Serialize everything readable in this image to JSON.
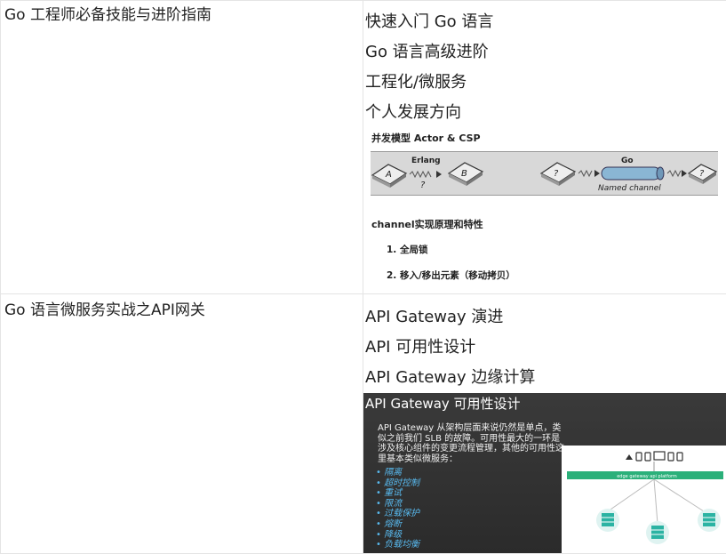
{
  "rows": [
    {
      "course": "Go 工程师必备技能与进阶指南",
      "topics": [
        "快速入门 Go 语言",
        "Go 语言高级进阶",
        "工程化/微服务",
        "个人发展方向"
      ],
      "figure": {
        "heading": "并发模型 Actor & CSP",
        "erlang_label": "Erlang",
        "go_label": "Go",
        "node_a": "A",
        "node_b": "B",
        "q": "?",
        "named_channel": "Named channel",
        "subheading": "channel实现原理和特性",
        "items": [
          "1.  全局锁",
          "2.  移入/移出元素（移动拷贝）"
        ]
      }
    },
    {
      "course": "Go 语言微服务实战之API网关",
      "topics": [
        "API Gateway 演进",
        "API 可用性设计",
        "API Gateway 边缘计算"
      ],
      "figure": {
        "title": "API Gateway 可用性设计",
        "paragraph": "API Gateway 从架构层面来说仍然是单点，类似之前我们 SLB 的故障。可用性最大的一环是涉及核心组件的变更流程管理，其他的可用性这里基本类似微服务：",
        "bullets": [
          "隔离",
          "超时控制",
          "重试",
          "限流",
          "过载保护",
          "熔断",
          "降级",
          "负载均衡"
        ],
        "bar_label": "edge gateway   api platform"
      }
    }
  ],
  "colors": {
    "border": "#e4e4e4",
    "slide_bg": "#333333",
    "bullet": "#58b9ee",
    "gateway_bar": "#2bb07a",
    "server": "#2bb3a3"
  }
}
